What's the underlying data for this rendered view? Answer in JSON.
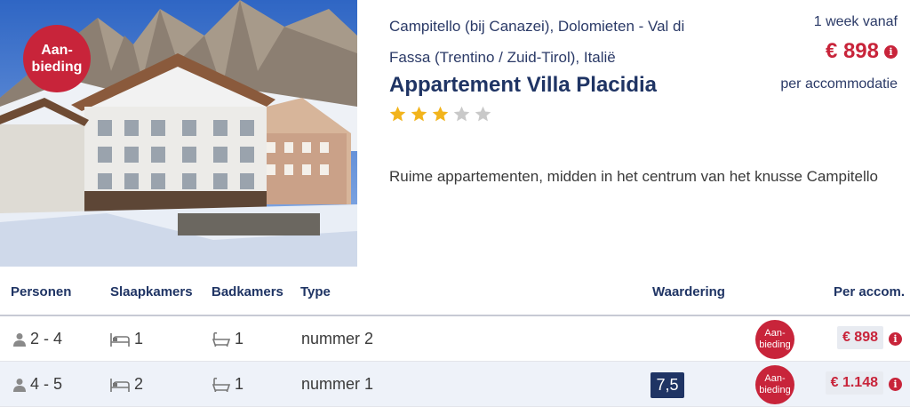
{
  "hero": {
    "badge_line1": "Aan-",
    "badge_line2": "bieding"
  },
  "accommodation": {
    "location_line1": "Campitello (bij Canazei), Dolomieten - Val di",
    "location_line2": "Fassa (Trentino / Zuid-Tirol), Italië",
    "title": "Appartement Villa Placidia",
    "stars": 3,
    "max_stars": 5,
    "description": "Ruime appartementen, midden in het centrum van het knusse Campitello"
  },
  "price": {
    "week_label": "1 week vanaf",
    "amount": "€ 898",
    "per_label": "per accommodatie"
  },
  "table": {
    "headers": {
      "persons": "Personen",
      "bedrooms": "Slaapkamers",
      "bathrooms": "Badkamers",
      "type": "Type",
      "rating": "Waardering",
      "price": "Per accom."
    },
    "rows": [
      {
        "persons": "2 - 4",
        "bedrooms": "1",
        "bathrooms": "1",
        "type": "nummer 2",
        "rating": "",
        "badge_line1": "Aan-",
        "badge_line2": "bieding",
        "price": "€ 898"
      },
      {
        "persons": "4 - 5",
        "bedrooms": "2",
        "bathrooms": "1",
        "type": "nummer 1",
        "rating": "7,5",
        "badge_line1": "Aan-",
        "badge_line2": "bieding",
        "price": "€ 1.148"
      }
    ]
  },
  "colors": {
    "brand_red": "#c8243a",
    "navy": "#1f3464",
    "star_on": "#f2b41c",
    "star_off": "#c9c9c9"
  },
  "icons": {
    "info": "info-icon",
    "person": "person-icon",
    "bed": "bed-icon",
    "bath": "bath-icon",
    "star": "star-icon"
  }
}
